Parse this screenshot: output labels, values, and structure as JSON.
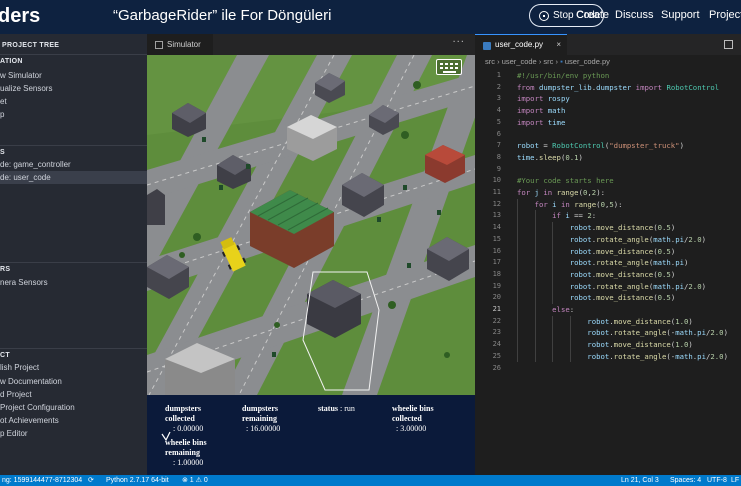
{
  "header": {
    "brand": "ders",
    "title": "“GarbageRider” ile For Döngüleri",
    "stop_label": "Stop Code",
    "nav": [
      "Create",
      "Discuss",
      "Support",
      "Projects"
    ]
  },
  "sidebar": {
    "project_tree_title": "PROJECT TREE",
    "sections": {
      "s1": "ATION",
      "s2": "S",
      "s3": "RS",
      "s4": "CT"
    },
    "items": {
      "simulator": "w Simulator",
      "sensors": "ualize Sensors",
      "reset": "et",
      "help": "p",
      "game_controller": "de: game_controller",
      "user_code": "de: user_code",
      "camera": "nera Sensors",
      "publish": "lish Project",
      "docs": "w Documentation",
      "load": "d Project",
      "config": " Project Configuration",
      "achievements": "ot Achievements",
      "editor": "p Editor"
    }
  },
  "simulator": {
    "tab_label": "Simulator",
    "more": "···"
  },
  "stats": {
    "dumpsters_collected": {
      "label_1": "dumpsters",
      "label_2": "collected",
      "value": ": 0.00000"
    },
    "dumpsters_remaining": {
      "label_1": "dumpsters",
      "label_2": "remaining",
      "value": ": 16.00000"
    },
    "status": {
      "label": "status",
      "value": ": run"
    },
    "wheelie_collected": {
      "label_1": "wheelie bins",
      "label_2": "collected",
      "value": ": 3.00000"
    },
    "wheelie_remaining": {
      "label_1": "wheelie bins",
      "label_2": "remaining",
      "value": ": 1.00000"
    }
  },
  "editor": {
    "tab_label": "user_code.py",
    "close": "×",
    "breadcrumb": [
      "src",
      "user_code",
      "src",
      "user_code.py"
    ],
    "current_line": 21,
    "lines": [
      "#!/usr/bin/env python",
      "from dumpster_lib.dumpster import RobotControl",
      "import rospy",
      "import math",
      "import time",
      "",
      "robot = RobotControl(\"dumpster_truck\")",
      "time.sleep(0.1)",
      "",
      "#Your code starts here",
      "for j in range(0,2):",
      "    for i in range(0,5):",
      "        if i == 2:",
      "            robot.move_distance(0.5)",
      "            robot.rotate_angle(math.pi/2.0)",
      "            robot.move_distance(0.5)",
      "            robot.rotate_angle(math.pi)",
      "            robot.move_distance(0.5)",
      "            robot.rotate_angle(math.pi/2.0)",
      "            robot.move_distance(0.5)",
      "        else:",
      "                robot.move_distance(1.0)",
      "                robot.rotate_angle(-math.pi/2.0)",
      "                robot.move_distance(1.0)",
      "                robot.rotate_angle(-math.pi/2.0)",
      ""
    ]
  },
  "statusbar": {
    "branch": "ng: 1599144477-8712304",
    "python": "Python 2.7.17 64-bit",
    "problems": "⊗ 1  ⚠ 0",
    "cursor": "Ln 21, Col 3",
    "spaces": "Spaces: 4",
    "encoding": "UTF-8",
    "eol": "LF"
  },
  "colors": {
    "header_bg": "#0e2240",
    "sidebar_bg": "#262a33",
    "editor_bg": "#1e1e1e",
    "status_bg": "#007acc",
    "stats_bg": "#0b1a3a",
    "keyword": "#c586c0",
    "builtin": "#569cd6",
    "string": "#ce9178",
    "number": "#b5cea8",
    "comment": "#6a9955",
    "function": "#dcdcaa",
    "type": "#4ec9b0"
  }
}
